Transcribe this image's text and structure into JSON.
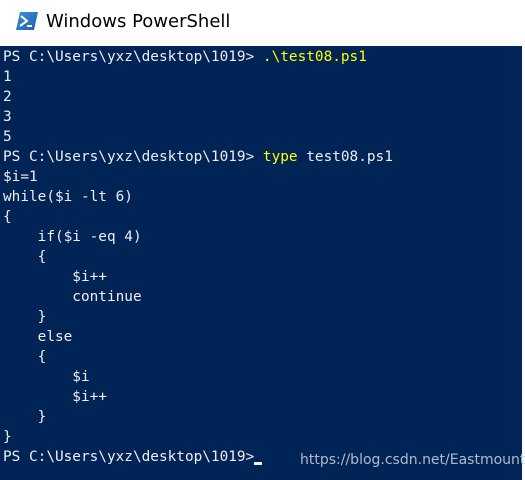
{
  "window": {
    "title": "Windows PowerShell",
    "icon": "powershell-icon"
  },
  "colors": {
    "console_bg": "#012456",
    "console_fg": "#eeedf0",
    "command_highlight": "#ffff00"
  },
  "console": {
    "lines": [
      {
        "text": "PS C:\\Users\\yxz\\desktop\\1019> ",
        "cmd": ".\\test08.ps1",
        "arg": ""
      },
      {
        "text": "1"
      },
      {
        "text": "2"
      },
      {
        "text": "3"
      },
      {
        "text": "5"
      },
      {
        "text": "PS C:\\Users\\yxz\\desktop\\1019> ",
        "cmd": "type",
        "arg": " test08.ps1"
      },
      {
        "text": "$i=1"
      },
      {
        "text": "while($i -lt 6)"
      },
      {
        "text": "{"
      },
      {
        "text": "    if($i -eq 4)"
      },
      {
        "text": "    {"
      },
      {
        "text": "        $i++"
      },
      {
        "text": "        continue"
      },
      {
        "text": "    }"
      },
      {
        "text": "    else"
      },
      {
        "text": "    {"
      },
      {
        "text": "        $i"
      },
      {
        "text": "        $i++"
      },
      {
        "text": "    }"
      },
      {
        "text": "}"
      },
      {
        "text": "PS C:\\Users\\yxz\\desktop\\1019>",
        "cursor": true
      }
    ]
  },
  "watermark": "https://blog.csdn.net/Eastmount"
}
